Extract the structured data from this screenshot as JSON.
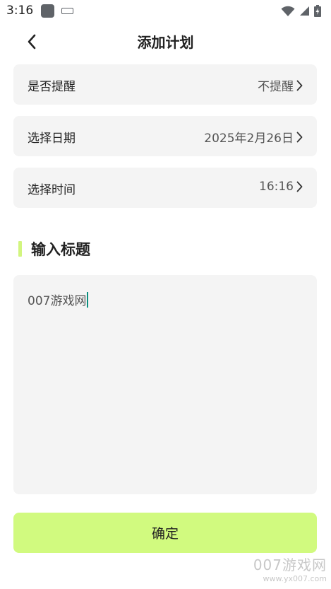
{
  "status_bar": {
    "time": "3:16",
    "icons": [
      "app-notification-icon",
      "keyboard-icon",
      "wifi-icon",
      "cellular-signal-icon",
      "battery-charging-icon"
    ]
  },
  "header": {
    "back_icon": "back-arrow-icon",
    "title": "添加计划"
  },
  "settings": {
    "reminder": {
      "label": "是否提醒",
      "value": "不提醒"
    },
    "date": {
      "label": "选择日期",
      "value": "2025年2月26日"
    },
    "time": {
      "label": "选择时间",
      "value": "16:16"
    }
  },
  "title_section": {
    "heading": "输入标题",
    "input_value": "007游戏网"
  },
  "confirm": {
    "label": "确定"
  },
  "watermark": {
    "main": "007游戏网",
    "sub": "www.yx007.com"
  },
  "colors": {
    "accent": "#d1fa7f",
    "card_bg": "#f4f4f4",
    "cursor": "#0a8f7f"
  }
}
